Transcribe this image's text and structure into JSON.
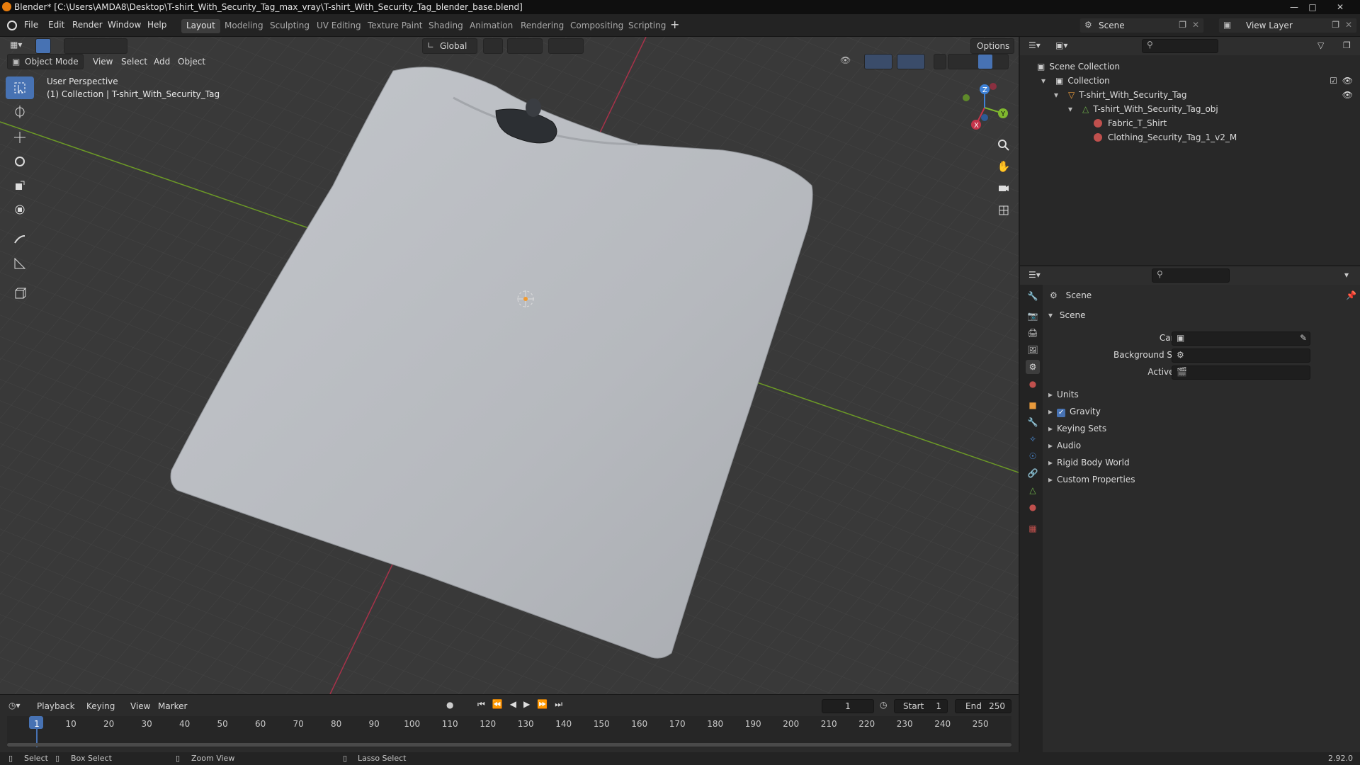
{
  "titlebar": {
    "title": "Blender* [C:\\Users\\AMDA8\\Desktop\\T-shirt_With_Security_Tag_max_vray\\T-shirt_With_Security_Tag_blender_base.blend]"
  },
  "menu": {
    "items": [
      "File",
      "Edit",
      "Render",
      "Window",
      "Help"
    ]
  },
  "workspaces": [
    "Layout",
    "Modeling",
    "Sculpting",
    "UV Editing",
    "Texture Paint",
    "Shading",
    "Animation",
    "Rendering",
    "Compositing",
    "Scripting"
  ],
  "active_workspace": "Layout",
  "scene_selector": {
    "scene": "Scene",
    "view_layer": "View Layer"
  },
  "viewport": {
    "mode": "Object Mode",
    "menus": [
      "View",
      "Select",
      "Add",
      "Object"
    ],
    "transform_orientation": "Global",
    "options_label": "Options",
    "overlay_title": "User Perspective",
    "overlay_subtitle": "(1) Collection | T-shirt_With_Security_Tag"
  },
  "outliner": {
    "root": "Scene Collection",
    "items": [
      {
        "label": "Collection"
      },
      {
        "label": "T-shirt_With_Security_Tag"
      },
      {
        "label": "T-shirt_With_Security_Tag_obj"
      },
      {
        "label": "Fabric_T_Shirt"
      },
      {
        "label": "Clothing_Security_Tag_1_v2_M"
      }
    ]
  },
  "properties": {
    "context": "Scene",
    "section": "Scene",
    "fields": [
      {
        "label": "Camera"
      },
      {
        "label": "Background Scene"
      },
      {
        "label": "Active Clip"
      }
    ],
    "panels": [
      "Units",
      "Gravity",
      "Keying Sets",
      "Audio",
      "Rigid Body World",
      "Custom Properties"
    ],
    "gravity_checked": true
  },
  "timeline": {
    "menus": [
      "Playback",
      "Keying",
      "View",
      "Marker"
    ],
    "current_frame": "1",
    "start_label": "Start",
    "start": "1",
    "end_label": "End",
    "end": "250",
    "ticks": [
      "1",
      "10",
      "20",
      "30",
      "40",
      "50",
      "60",
      "70",
      "80",
      "90",
      "100",
      "110",
      "120",
      "130",
      "140",
      "150",
      "160",
      "170",
      "180",
      "190",
      "200",
      "210",
      "220",
      "230",
      "240",
      "250"
    ]
  },
  "statusbar": {
    "select": "Select",
    "box_select": "Box Select",
    "zoom_view": "Zoom View",
    "lasso_select": "Lasso Select",
    "version": "2.92.0"
  },
  "colors": {
    "accent": "#4772b3",
    "viewport_bg": "#3a3a3a",
    "shirt": "#b9bcc1",
    "x_axis": "#c4344a",
    "y_axis": "#7fb82e"
  }
}
